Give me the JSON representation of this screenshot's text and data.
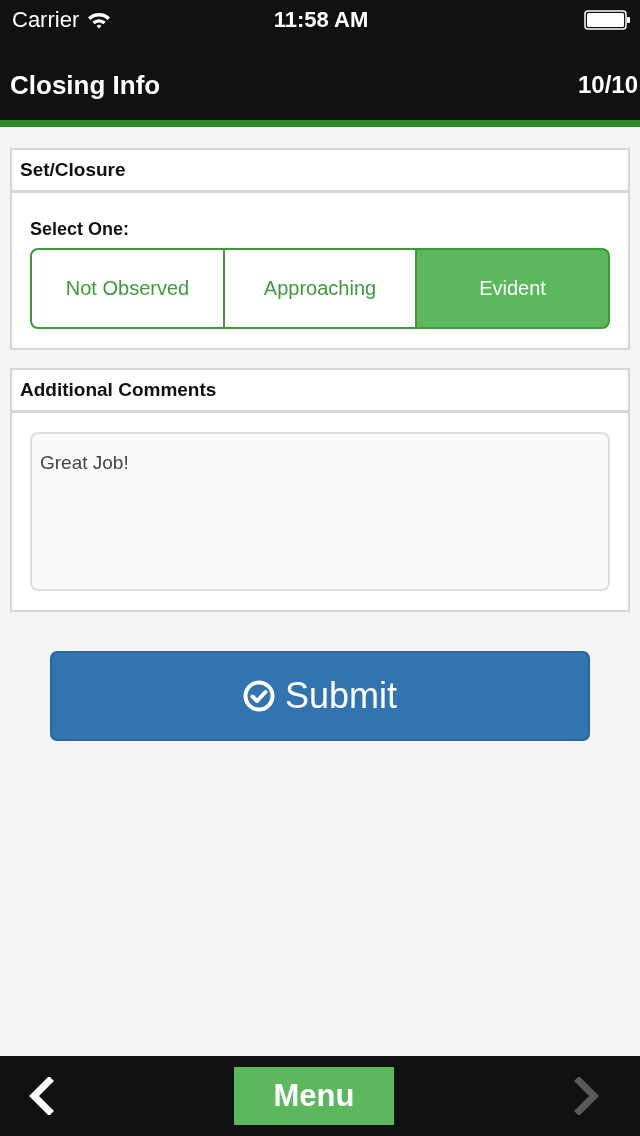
{
  "status_bar": {
    "carrier": "Carrier",
    "time": "11:58 AM"
  },
  "header": {
    "title": "Closing Info",
    "progress": "10/10"
  },
  "sections": [
    {
      "kind": "choice",
      "title": "Set/Closure",
      "prompt": "Select One:",
      "options": [
        {
          "label": "Not Observed",
          "selected": false
        },
        {
          "label": "Approaching",
          "selected": false
        },
        {
          "label": "Evident",
          "selected": true
        }
      ]
    },
    {
      "kind": "comments",
      "title": "Additional Comments",
      "value": "Great Job!"
    }
  ],
  "submit": {
    "label": "Submit"
  },
  "footer": {
    "back": {
      "disabled": false
    },
    "menu": {
      "label": "Menu"
    },
    "next": {
      "disabled": true
    }
  }
}
